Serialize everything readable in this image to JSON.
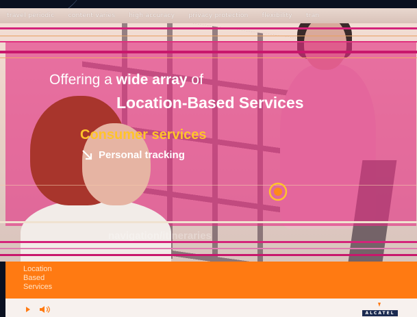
{
  "taglines": [
    "travel periodic",
    "content varies",
    "high accuracy",
    "privacy protection",
    "flexibility",
    "tran"
  ],
  "headline": {
    "line1_prefix": "Offering a ",
    "line1_bold": "wide array",
    "line1_suffix": " of",
    "line2": "Location-Based Services"
  },
  "category": "Consumer services",
  "subcategory": {
    "arrow_icon": "arrow-down-right-icon",
    "label": "Personal tracking"
  },
  "faded_text": "navigation/itineraries",
  "footer": {
    "lbs_lines": [
      "Location",
      "Based",
      "Services"
    ],
    "play_icon": "play-icon",
    "volume_icon": "volume-icon",
    "logo_text": "ALCATEL"
  },
  "colors": {
    "pink_overlay": "#e22e82",
    "accent_yellow": "#ffc42a",
    "orange": "#ff7a12",
    "navy": "#1a2a50"
  }
}
